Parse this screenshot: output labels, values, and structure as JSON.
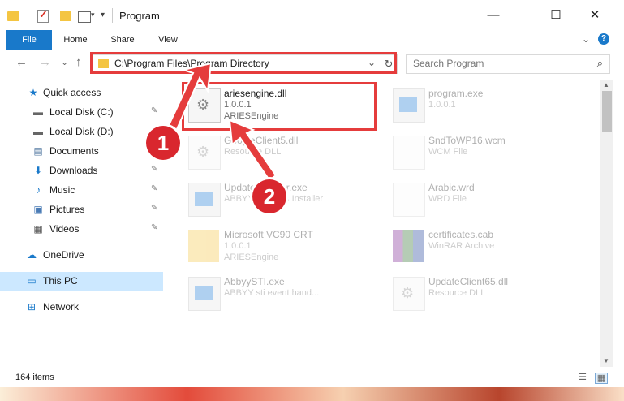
{
  "window": {
    "title": "Program",
    "minimize_glyph": "—",
    "maximize_glyph": "☐",
    "close_glyph": "✕"
  },
  "quick_access_toolbar": {
    "icons": [
      "folder-icon",
      "properties-check-icon",
      "new-folder-icon",
      "view-icon",
      "customize-arrow-icon"
    ]
  },
  "ribbon": {
    "tabs": [
      {
        "label": "File",
        "active": true
      },
      {
        "label": "Home"
      },
      {
        "label": "Share"
      },
      {
        "label": "View"
      }
    ],
    "expand_glyph": "⌄",
    "help_glyph": "?"
  },
  "navigation": {
    "back_glyph": "←",
    "forward_glyph": "→",
    "recent_glyph": "⌄",
    "up_glyph": "↑",
    "address_path": "C:\\Program Files\\Program Directory",
    "address_dropdown_glyph": "⌄",
    "refresh_glyph": "↻",
    "search_placeholder": "Search Program",
    "search_icon_glyph": "⌕"
  },
  "sidebar": {
    "items": [
      {
        "label": "Quick access",
        "icon": "star-icon",
        "glyph": "★",
        "color": "#1979ca"
      },
      {
        "label": "Local Disk (C:)",
        "icon": "drive-icon",
        "glyph": "▬",
        "color": "#666666",
        "pinned": true
      },
      {
        "label": "Local Disk (D:)",
        "icon": "drive-icon",
        "glyph": "▬",
        "color": "#666666",
        "pinned": true
      },
      {
        "label": "Documents",
        "icon": "documents-icon",
        "glyph": "▤",
        "color": "#5b7fa6",
        "pinned": true
      },
      {
        "label": "Downloads",
        "icon": "download-icon",
        "glyph": "⬇",
        "color": "#1979ca",
        "pinned": true
      },
      {
        "label": "Music",
        "icon": "music-icon",
        "glyph": "♪",
        "color": "#1979ca",
        "pinned": true
      },
      {
        "label": "Pictures",
        "icon": "pictures-icon",
        "glyph": "▣",
        "color": "#4a7bb5",
        "pinned": true
      },
      {
        "label": "Videos",
        "icon": "videos-icon",
        "glyph": "▦",
        "color": "#555555",
        "pinned": true
      },
      {
        "label": "OneDrive",
        "icon": "cloud-icon",
        "glyph": "☁",
        "color": "#1979ca"
      },
      {
        "label": "This PC",
        "icon": "computer-icon",
        "glyph": "▭",
        "color": "#1979ca",
        "selected": true
      },
      {
        "label": "Network",
        "icon": "network-icon",
        "glyph": "⊞",
        "color": "#1979ca"
      }
    ],
    "pin_glyph": "📌"
  },
  "files": [
    {
      "name": "ariesengine.dll",
      "line1": "1.0.0.1",
      "line2": "ARIESEngine",
      "icon": "gear-doc"
    },
    {
      "name": "program.exe",
      "line1": "1.0.0.1",
      "line2": "",
      "icon": "exe"
    },
    {
      "name": "GoogleClient5.dll",
      "line1": "Resource DLL",
      "line2": "",
      "icon": "gear-doc"
    },
    {
      "name": "SndToWP16.wcm",
      "line1": "WCM File",
      "line2": "",
      "icon": "blank"
    },
    {
      "name": "UpdateInstaller.exe",
      "line1": "ABBYY Updates Installer",
      "line2": "",
      "icon": "exe"
    },
    {
      "name": "Arabic.wrd",
      "line1": "WRD File",
      "line2": "",
      "icon": "blank"
    },
    {
      "name": "Microsoft VC90 CRT",
      "line1": "1.0.0.1",
      "line2": "ARIESEngine",
      "icon": "folder"
    },
    {
      "name": "certificates.cab",
      "line1": "WinRAR Archive",
      "line2": "",
      "icon": "rar"
    },
    {
      "name": "AbbyySTI.exe",
      "line1": "ABBYY sti event hand...",
      "line2": "",
      "icon": "exe"
    },
    {
      "name": "UpdateClient65.dll",
      "line1": "Resource DLL",
      "line2": "",
      "icon": "gear-doc"
    }
  ],
  "status": {
    "item_count": "164 items",
    "details_view_glyph": "☰",
    "tiles_view_glyph": "▦"
  },
  "annotations": {
    "step1": "1",
    "step2": "2",
    "highlight_color": "#e53c3c"
  },
  "scrollbar": {
    "up_glyph": "▲",
    "down_glyph": "▼"
  }
}
